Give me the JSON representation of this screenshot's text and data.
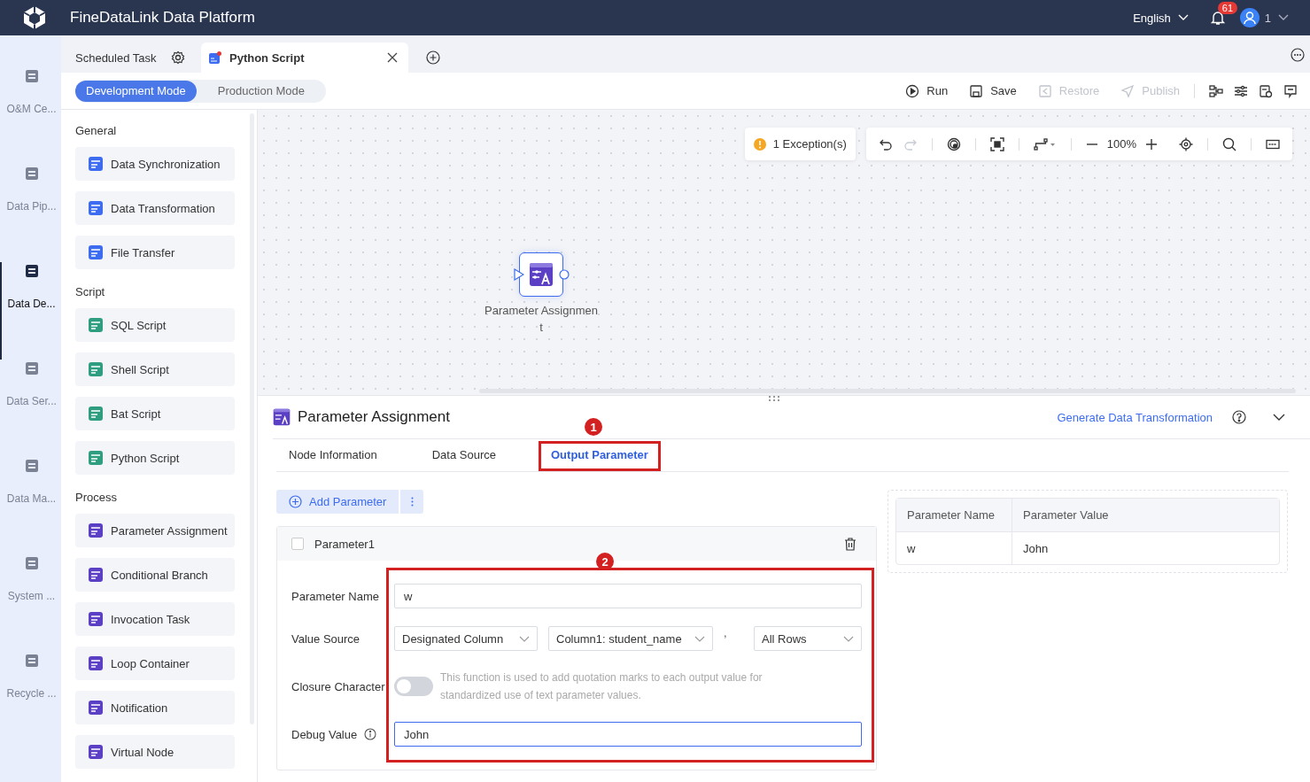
{
  "app": {
    "title": "FineDataLink Data Platform",
    "language": "English",
    "notification_count": "61",
    "user": "1"
  },
  "nav": [
    {
      "label": "O&M Ce...",
      "selected": false
    },
    {
      "label": "Data Pip...",
      "selected": false
    },
    {
      "label": "Data De...",
      "selected": true
    },
    {
      "label": "Data Ser...",
      "selected": false
    },
    {
      "label": "Data Ma...",
      "selected": false
    },
    {
      "label": "System ...",
      "selected": false
    },
    {
      "label": "Recycle ...",
      "selected": false
    }
  ],
  "tabs": [
    {
      "label": "Scheduled Task",
      "selected": false
    },
    {
      "label": "Python Script",
      "selected": true
    }
  ],
  "modes": [
    {
      "label": "Development Mode",
      "selected": true
    },
    {
      "label": "Production Mode",
      "selected": false
    }
  ],
  "actions": [
    {
      "label": "Run",
      "disabled": false
    },
    {
      "label": "Save",
      "disabled": false
    },
    {
      "label": "Restore",
      "disabled": true
    },
    {
      "label": "Publish",
      "disabled": true
    }
  ],
  "palette": [
    {
      "section": "General",
      "items": [
        "Data Synchronization",
        "Data Transformation",
        "File Transfer"
      ]
    },
    {
      "section": "Script",
      "items": [
        "SQL Script",
        "Shell Script",
        "Bat Script",
        "Python Script"
      ]
    },
    {
      "section": "Process",
      "items": [
        "Parameter Assignment",
        "Conditional Branch",
        "Invocation Task",
        "Loop Container",
        "Notification",
        "Virtual Node"
      ]
    }
  ],
  "canvas": {
    "exceptions": "1 Exception(s)",
    "redo_disabled": true,
    "zoom": "100%",
    "node": {
      "label": "Parameter Assignment"
    }
  },
  "panel": {
    "title": "Parameter Assignment",
    "link": "Generate Data Transformation",
    "tabs": [
      {
        "label": "Node Information",
        "selected": false
      },
      {
        "label": "Data Source",
        "selected": false
      },
      {
        "label": "Output Parameter",
        "selected": true
      }
    ],
    "add_button": "Add Parameter",
    "parameter": {
      "name": "Parameter1",
      "checked": false,
      "name_label": "Parameter Name",
      "name_value": "w",
      "source_label": "Value Source",
      "source_selects": [
        "Designated Column",
        "Column1: student_name",
        "All Rows"
      ],
      "separator": ",",
      "closure_label": "Closure Character",
      "closure_on": false,
      "closure_hint": "This function is used to add quotation marks to each output value for standardized use of text parameter values.",
      "debug_label": "Debug Value",
      "debug_value": "John",
      "debug_focused": true
    },
    "preview": {
      "columns": [
        "Parameter Name",
        "Parameter Value"
      ],
      "rows": [
        [
          "w",
          "John"
        ]
      ]
    }
  },
  "annotations": [
    {
      "label": "1"
    },
    {
      "label": "2"
    }
  ]
}
